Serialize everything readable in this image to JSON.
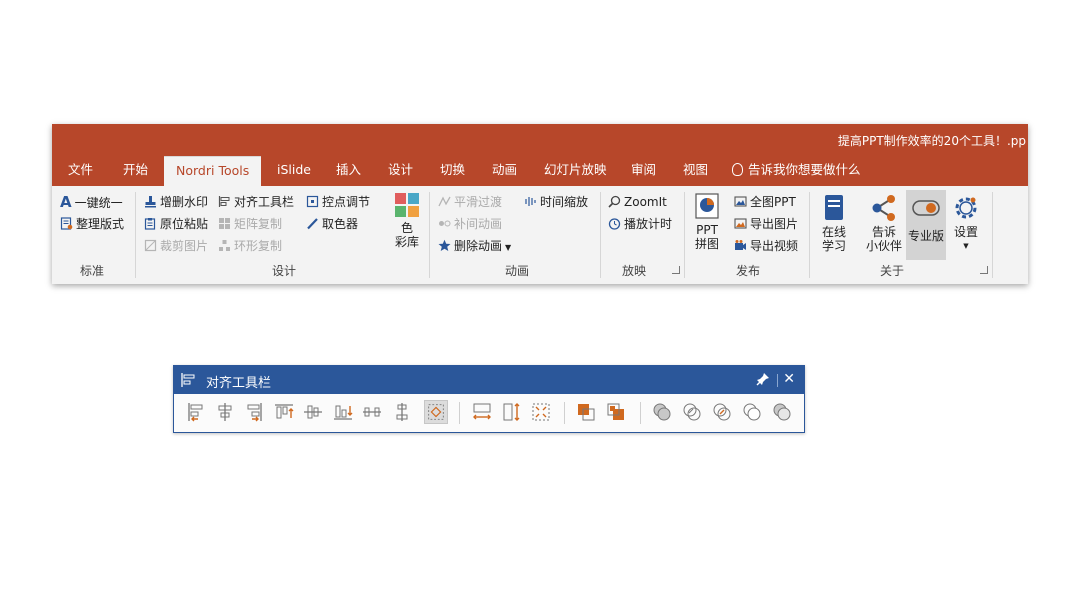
{
  "window": {
    "title": "提高PPT制作效率的20个工具！.pp"
  },
  "tabs": [
    {
      "id": "file",
      "label": "文件"
    },
    {
      "id": "home",
      "label": "开始"
    },
    {
      "id": "nordri",
      "label": "Nordri Tools"
    },
    {
      "id": "islide",
      "label": "iSlide"
    },
    {
      "id": "insert",
      "label": "插入"
    },
    {
      "id": "design",
      "label": "设计"
    },
    {
      "id": "transitions",
      "label": "切换"
    },
    {
      "id": "animations",
      "label": "动画"
    },
    {
      "id": "slideshow",
      "label": "幻灯片放映"
    },
    {
      "id": "review",
      "label": "审阅"
    },
    {
      "id": "view",
      "label": "视图"
    }
  ],
  "tell_me": "告诉我你想要做什么",
  "groups": {
    "standard": {
      "label": "标准",
      "cmds": [
        "一键统一",
        "整理版式"
      ]
    },
    "design": {
      "label": "设计",
      "cmds": [
        "增删水印",
        "原位粘贴",
        "裁剪图片",
        "对齐工具栏",
        "矩阵复制",
        "环形复制",
        "控点调节",
        "取色器"
      ],
      "palette_line1": "色",
      "palette_line2": "彩库"
    },
    "animation": {
      "label": "动画",
      "cmds": [
        "平滑过渡",
        "补间动画",
        "删除动画",
        "时间缩放"
      ]
    },
    "slideshow": {
      "label": "放映",
      "cmds": [
        "ZoomIt",
        "播放计时"
      ]
    },
    "publish": {
      "label": "发布",
      "ppt_line1": "PPT",
      "ppt_line2": "拼图",
      "cmds": [
        "全图PPT",
        "导出图片",
        "导出视频"
      ]
    },
    "about": {
      "label": "关于",
      "online_1": "在线",
      "online_2": "学习",
      "tell_1": "告诉",
      "tell_2": "小伙伴",
      "pro": "专业版",
      "settings": "设置"
    }
  },
  "colors": {
    "accent": "#b7472a",
    "toolbar_blue": "#2b579a",
    "icon_orange": "#d0691f",
    "icon_blue": "#2b579a"
  },
  "align_toolbar": {
    "title": "对齐工具栏",
    "pin_icon": "pin-icon",
    "close_glyph": "✕"
  }
}
